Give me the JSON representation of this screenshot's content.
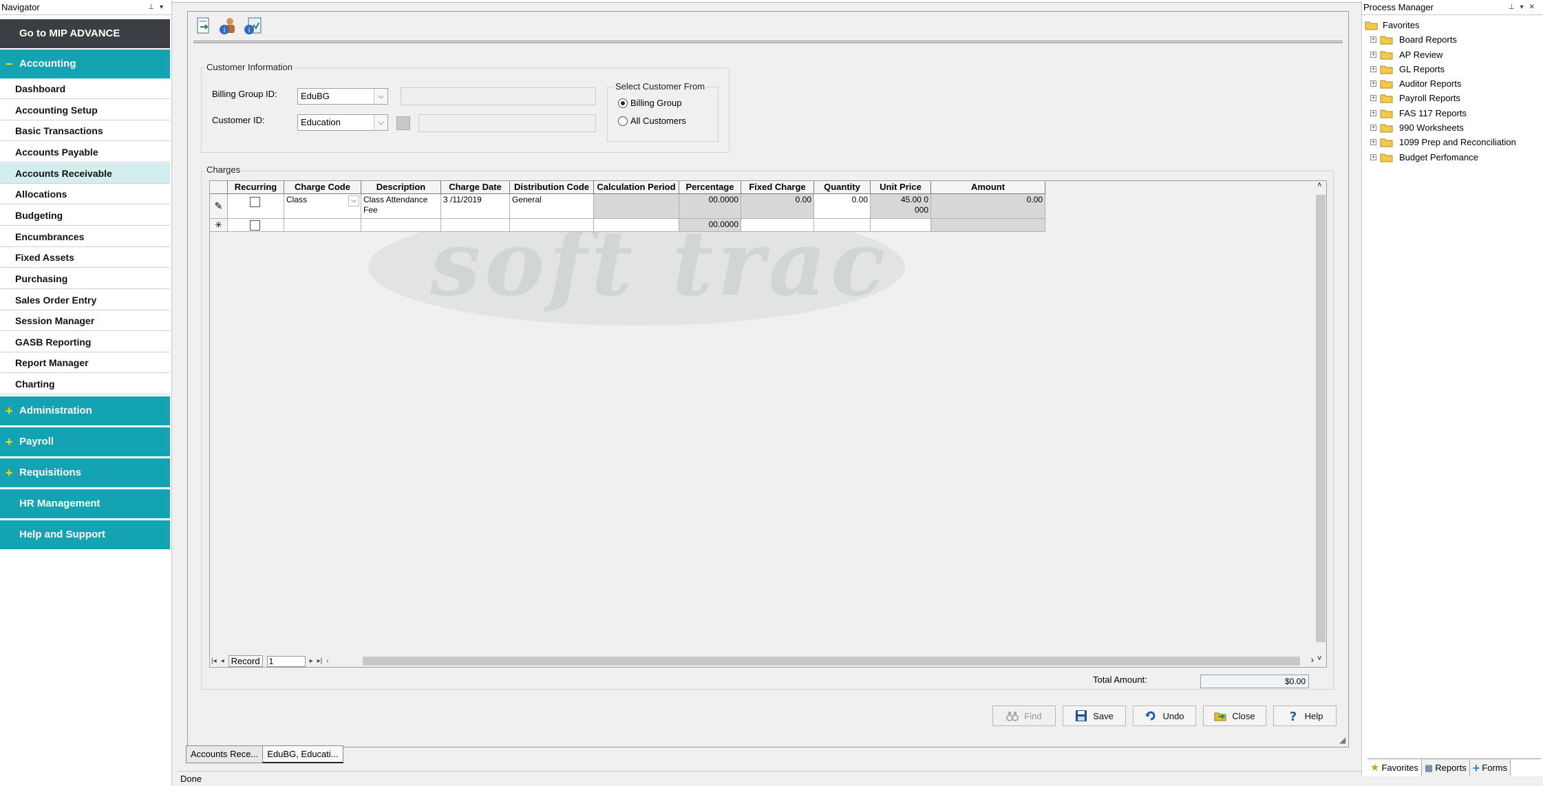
{
  "navigator": {
    "title": "Navigator",
    "goto": "Go to MIP ADVANCE",
    "accounting": {
      "sign": "−",
      "label": "Accounting"
    },
    "items": [
      {
        "label": "Dashboard"
      },
      {
        "label": "Accounting Setup"
      },
      {
        "label": "Basic Transactions"
      },
      {
        "label": "Accounts Payable"
      },
      {
        "label": "Accounts Receivable"
      },
      {
        "label": "Allocations"
      },
      {
        "label": "Budgeting"
      },
      {
        "label": "Encumbrances"
      },
      {
        "label": "Fixed Assets"
      },
      {
        "label": "Purchasing"
      },
      {
        "label": "Sales Order Entry"
      },
      {
        "label": "Session Manager"
      },
      {
        "label": "GASB Reporting"
      },
      {
        "label": "Report Manager"
      },
      {
        "label": "Charting"
      }
    ],
    "sections": [
      {
        "sign": "+",
        "label": "Administration"
      },
      {
        "sign": "+",
        "label": "Payroll"
      },
      {
        "sign": "+",
        "label": "Requisitions"
      },
      {
        "sign": "",
        "label": "HR Management"
      },
      {
        "sign": "",
        "label": "Help and Support"
      }
    ]
  },
  "customer_info": {
    "title": "Customer Information",
    "billing_group_label": "Billing Group ID:",
    "billing_group_value": "EduBG",
    "customer_id_label": "Customer ID:",
    "customer_id_value": "Education",
    "select_from_title": "Select Customer From",
    "option_billing_group": "Billing Group",
    "option_all_customers": "All Customers",
    "selected_option": "Billing Group"
  },
  "charges": {
    "title": "Charges",
    "columns": [
      "Recurring",
      "Charge Code",
      "Description",
      "Charge Date",
      "Distribution Code",
      "Calculation Period",
      "Percentage",
      "Fixed Charge",
      "Quantity",
      "Unit Price",
      "Amount"
    ],
    "row1": {
      "recurring": false,
      "charge_code": "Class",
      "description": "Class Attendance Fee",
      "charge_date": "3 /11/2019",
      "distribution_code": "General",
      "calculation_period": "",
      "percentage": "00.0000",
      "fixed_charge": "0.00",
      "quantity": "0.00",
      "unit_price": "45.00 0000",
      "amount": "0.00"
    },
    "row2": {
      "percentage": "00.0000"
    },
    "record_label": "Record",
    "record_number": "1"
  },
  "total": {
    "label": "Total Amount:",
    "value": "$0.00"
  },
  "buttons": {
    "find": "Find",
    "save": "Save",
    "undo": "Undo",
    "close": "Close",
    "help": "Help"
  },
  "tabs": [
    "Accounts Rece...",
    "EduBG, Educati..."
  ],
  "status": "Done",
  "process_manager": {
    "title": "Process Manager",
    "root": "Favorites",
    "folders": [
      "Board Reports",
      "AP Review",
      "GL Reports",
      "Auditor Reports",
      "Payroll Reports",
      "FAS 117 Reports",
      "990 Worksheets",
      "1099 Prep and Reconciliation",
      "Budget Perfomance"
    ],
    "tabs": {
      "favorites": "Favorites",
      "reports": "Reports",
      "forms": "Forms"
    }
  },
  "colors": {
    "nav_section": "#13a3b3",
    "nav_goto": "#3b3f44",
    "nav_active": "#d4eef0",
    "folder": "#f2c94c"
  }
}
